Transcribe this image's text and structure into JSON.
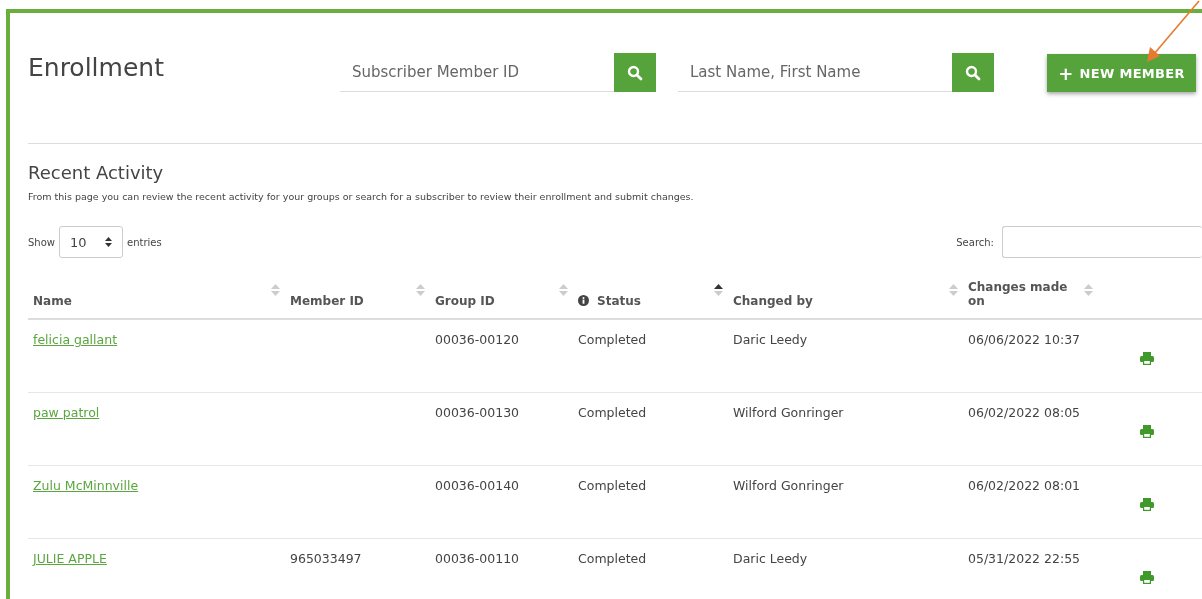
{
  "title": "Enrollment",
  "searches": [
    {
      "placeholder": "Subscriber Member ID"
    },
    {
      "placeholder": "Last Name, First Name"
    }
  ],
  "new_member_button": {
    "icon": "+",
    "label": "NEW MEMBER"
  },
  "section": {
    "title": "Recent Activity",
    "description": "From this page you can review the recent activity for your groups or search for a subscriber to review their enrollment and submit changes."
  },
  "length": {
    "before": "Show",
    "value": "10",
    "after": "entries"
  },
  "table_search": {
    "label": "Search:"
  },
  "table": {
    "columns": [
      {
        "label": "Name",
        "sorted": false,
        "info_icon": false
      },
      {
        "label": "Member ID",
        "sorted": false,
        "info_icon": false
      },
      {
        "label": "Group ID",
        "sorted": false,
        "info_icon": false
      },
      {
        "label": "Status",
        "sorted": true,
        "info_icon": true
      },
      {
        "label": "Changed by",
        "sorted": false,
        "info_icon": false
      },
      {
        "label": "Changes made on",
        "sorted": false,
        "info_icon": false
      }
    ],
    "rows": [
      {
        "name": "felicia gallant",
        "group_id": "00036-00120",
        "status": "Completed",
        "changed_by": "Daric Leedy",
        "changed_on": "06/06/2022 10:37"
      },
      {
        "name": "paw patrol",
        "group_id": "00036-00130",
        "status": "Completed",
        "changed_by": "Wilford Gonringer",
        "changed_on": "06/02/2022 08:05"
      },
      {
        "name": "Zulu McMinnville",
        "group_id": "00036-00140",
        "status": "Completed",
        "changed_by": "Wilford Gonringer",
        "changed_on": "06/02/2022 08:01"
      },
      {
        "name": "JULIE APPLE",
        "member_id": "965033497",
        "group_id": "00036-00110",
        "status": "Completed",
        "changed_by": "Daric Leedy",
        "changed_on": "05/31/2022 22:55"
      }
    ]
  }
}
